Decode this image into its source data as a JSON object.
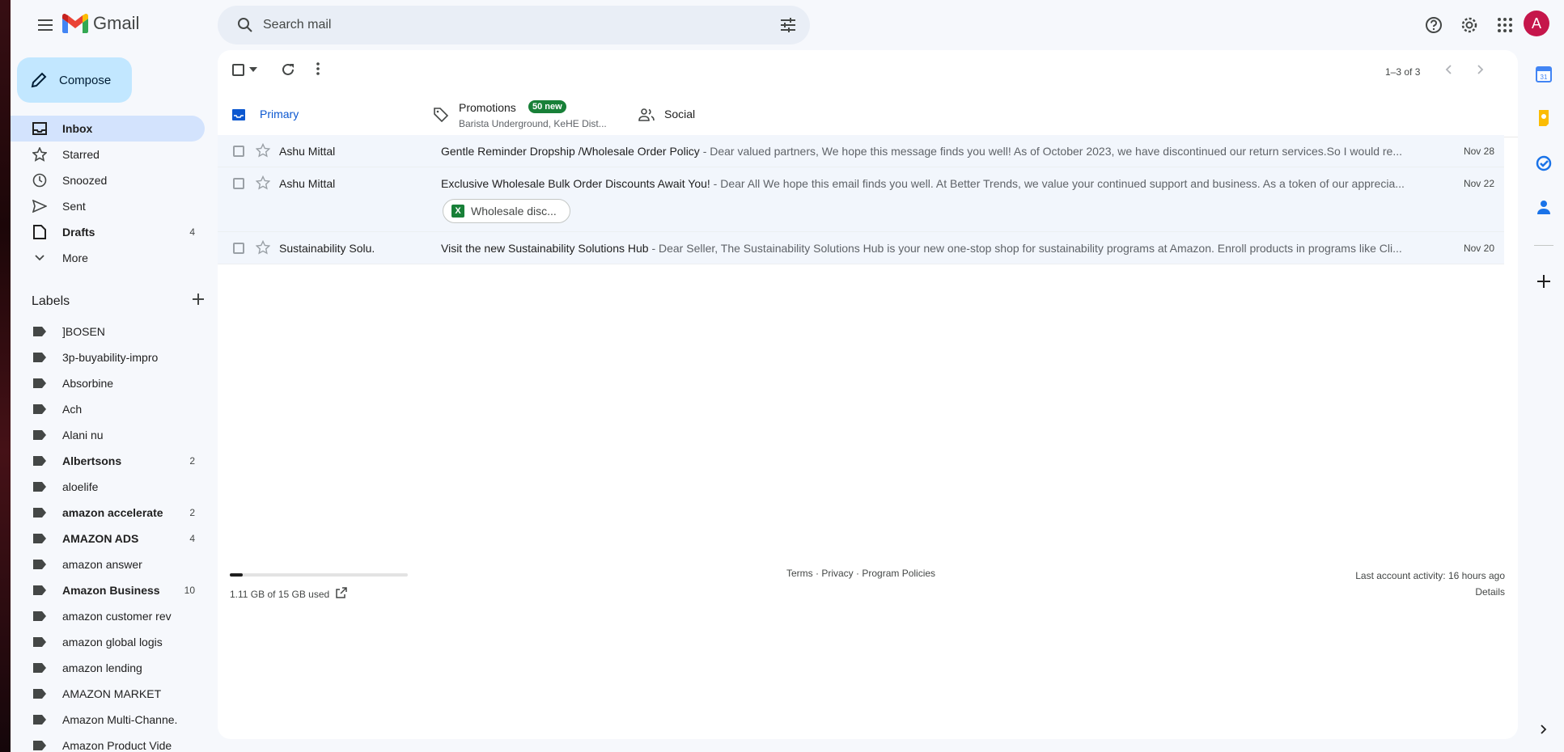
{
  "app": {
    "name": "Gmail"
  },
  "search": {
    "placeholder": "Search mail"
  },
  "header": {
    "avatar_letter": "A"
  },
  "compose": {
    "label": "Compose"
  },
  "nav": [
    {
      "label": "Inbox",
      "icon": "inbox-icon",
      "count": "",
      "active": true
    },
    {
      "label": "Starred",
      "icon": "star-icon",
      "count": ""
    },
    {
      "label": "Snoozed",
      "icon": "clock-icon",
      "count": ""
    },
    {
      "label": "Sent",
      "icon": "send-icon",
      "count": ""
    },
    {
      "label": "Drafts",
      "icon": "draft-icon",
      "count": "4",
      "bold": true
    },
    {
      "label": "More",
      "icon": "chevron-down-icon",
      "count": ""
    }
  ],
  "labels_title": "Labels",
  "labels": [
    {
      "name": "]BOSEN",
      "count": ""
    },
    {
      "name": "3p-buyability-impro",
      "count": ""
    },
    {
      "name": "Absorbine",
      "count": ""
    },
    {
      "name": "Ach",
      "count": ""
    },
    {
      "name": "Alani nu",
      "count": ""
    },
    {
      "name": "Albertsons",
      "count": "2",
      "bold": true
    },
    {
      "name": "aloelife",
      "count": ""
    },
    {
      "name": "amazon accelerate",
      "count": "2",
      "bold": true
    },
    {
      "name": "AMAZON ADS",
      "count": "4",
      "bold": true
    },
    {
      "name": "amazon answer",
      "count": ""
    },
    {
      "name": "Amazon Business",
      "count": "10",
      "bold": true
    },
    {
      "name": "amazon customer rev",
      "count": ""
    },
    {
      "name": "amazon global logis",
      "count": ""
    },
    {
      "name": "amazon lending",
      "count": ""
    },
    {
      "name": "AMAZON MARKET",
      "count": ""
    },
    {
      "name": "Amazon Multi-Channe.",
      "count": ""
    },
    {
      "name": "Amazon Product Vide",
      "count": ""
    }
  ],
  "toolbar": {
    "pager": "1–3 of 3"
  },
  "tabs": {
    "primary": {
      "label": "Primary"
    },
    "promotions": {
      "label": "Promotions",
      "badge": "50 new",
      "sub": "Barista Underground, KeHE Dist..."
    },
    "social": {
      "label": "Social"
    }
  },
  "emails": [
    {
      "sender": "Ashu Mittal",
      "subject": "Gentle Reminder Dropship /Wholesale Order Policy",
      "snippet": " - Dear valued partners, We hope this message finds you well! As of October 2023, we have discontinued our return services.So I would re...",
      "date": "Nov 28"
    },
    {
      "sender": "Ashu Mittal",
      "subject": "Exclusive Wholesale Bulk Order Discounts Await You!",
      "snippet": " - Dear All We hope this email finds you well. At Better Trends, we value your continued support and business. As a token of our apprecia...",
      "date": "Nov 22",
      "attachment": "Wholesale disc..."
    },
    {
      "sender": "Sustainability Solu.",
      "subject": "Visit the new Sustainability Solutions Hub",
      "snippet": " - Dear Seller, The Sustainability Solutions Hub is your new one-stop shop for sustainability programs at Amazon. Enroll products in programs like Cli...",
      "date": "Nov 20"
    }
  ],
  "footer": {
    "storage": "1.11 GB of 15 GB used",
    "storage_used_fraction": 0.074,
    "terms": "Terms",
    "privacy": "Privacy",
    "policies": "Program Policies",
    "activity": "Last account activity: 16 hours ago",
    "details": "Details"
  },
  "colors": {
    "accent": "#0b57d0",
    "compose_bg": "#c2e7ff",
    "active_nav": "#d3e3fd",
    "badge": "#188038",
    "avatar": "#c5164b"
  }
}
